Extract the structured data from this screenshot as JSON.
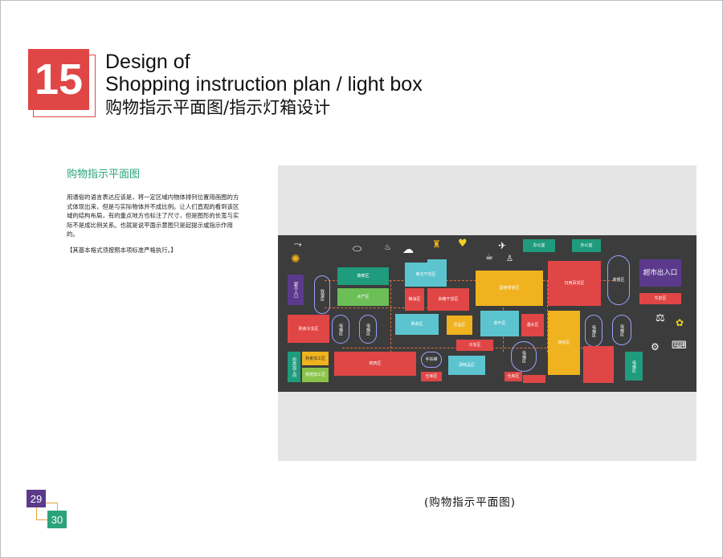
{
  "header": {
    "number": "15",
    "title_line1": "Design of",
    "title_line2": "Shopping instruction plan / light box",
    "title_cn": "购物指示平面图/指示灯箱设计"
  },
  "section": {
    "title": "购物指示平面图",
    "description": "用通俗的语言表达应该是，将一定区域内物体排列位置用画图的方式体现出来，但是与实际物体并不成比例。让人们直观的看到该区域的结构布局，有的重点地方也标注了尺寸，但是图形的长宽与实际不是成比例关系。也就是说平面示意图只是起提示或指示作用的。",
    "note": "【其基本格式须按照本项标准严格执行。】"
  },
  "map": {
    "zones": {
      "entrance_left": "超市入口",
      "cashier_left": "收银区",
      "vegetables": "蔬菜区",
      "water_products": "水产区",
      "cooked_food": "熟食冷冻区",
      "elevator_a": "电梯区",
      "elevator_b": "电梯区",
      "nuts": "南北干货区",
      "rice_oil": "粮油区",
      "dry_goods": "杂粮干货区",
      "snacks": "副食零食区",
      "daily_goods": "日用百货区",
      "cashier_right": "收银区",
      "exit": "超市出入口",
      "office_a": "办公室",
      "office_b": "办公室",
      "milk": "牛奶区",
      "cooked_b": "熟食区",
      "beverage": "饮品区",
      "tea": "茶叶区",
      "wine": "酒水区",
      "frozen": "冷冻区",
      "elevator_c": "电梯区",
      "stationery": "家纺区",
      "elevator_d": "电梯区",
      "elevator_e": "电梯区",
      "food_processing": "熟食加工区",
      "bakery": "烘焙加工区",
      "meat_processing": "肉类加工间",
      "fresh": "鲜肉区",
      "escalator": "手扶梯",
      "storage_a": "仓库区",
      "seasoning": "调味品区",
      "storage_b": "仓库区",
      "storage_c": "仓库区",
      "elevator_f": "电梯区"
    }
  },
  "caption": "(购物指示平面图)",
  "page": {
    "left": "29",
    "right": "30"
  },
  "colors": {
    "accent_red": "#e04646",
    "accent_green": "#29a37a",
    "purple": "#5b3a8c",
    "map_bg": "#3c3c3c",
    "yellow": "#f0b21e",
    "teal": "#1f9b7d",
    "cyan": "#5cc4cf",
    "orange_dash": "#e0703a"
  }
}
